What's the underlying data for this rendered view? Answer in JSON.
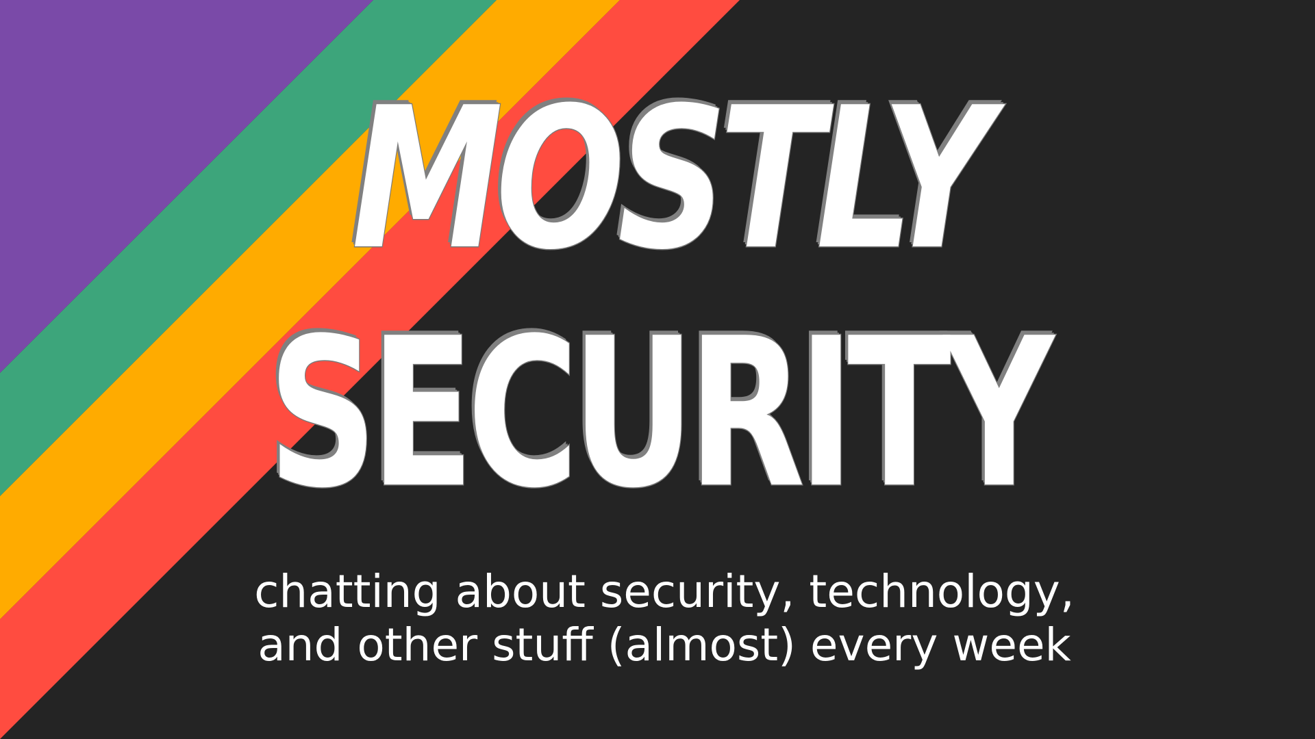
{
  "title": {
    "line1": "MOSTLY",
    "line2": "SECURITY"
  },
  "subtitle": {
    "line1": "chatting about security, technology,",
    "line2": "and other stuff (almost) every week"
  },
  "colors": {
    "background": "#242424",
    "stripe_purple": "#7a4aa8",
    "stripe_green": "#3da57b",
    "stripe_yellow": "#ffab00",
    "stripe_red": "#ff4c40",
    "text": "#ffffff",
    "text_shadow": "#808080"
  }
}
